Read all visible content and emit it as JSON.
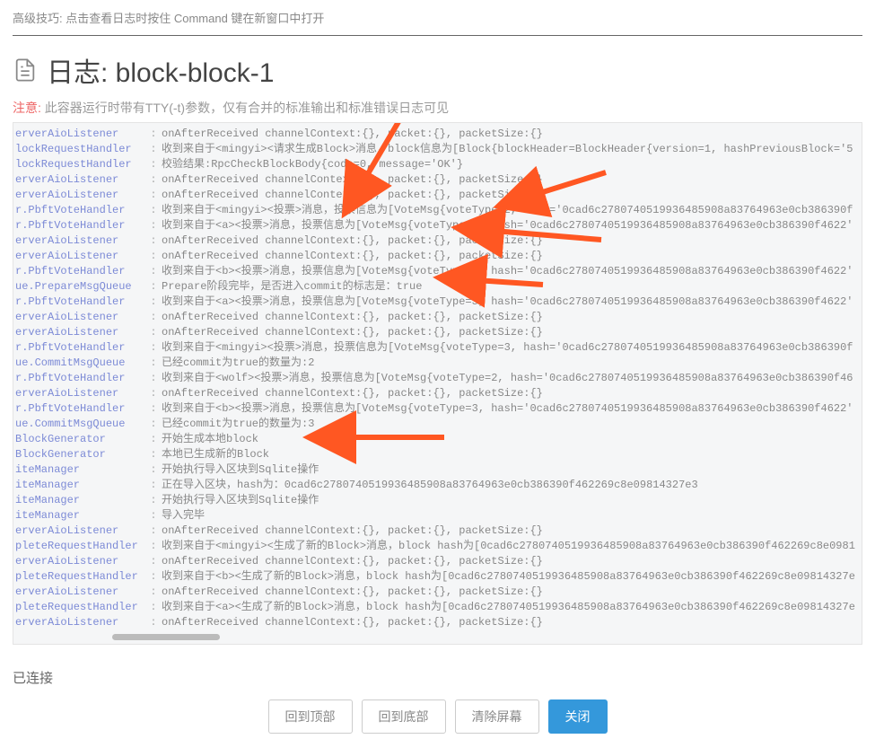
{
  "tip": "高级技巧: 点击查看日志时按住 Command 键在新窗口中打开",
  "title_prefix": "日志: ",
  "title_name": "block-block-1",
  "notice_label": "注意:",
  "notice_text": " 此容器运行时带有TTY(-t)参数，仅有合并的标准输出和标准错误日志可见",
  "status": "已连接",
  "buttons": {
    "top": "回到顶部",
    "bottom": "回到底部",
    "clear": "清除屏幕",
    "close": "关闭"
  },
  "log_lines": [
    {
      "src": "erverAioListener",
      "msg": "onAfterReceived channelContext:{}, packet:{}, packetSize:{}"
    },
    {
      "src": "lockRequestHandler",
      "msg": "收到来自于<mingyi><请求生成Block>消息，block信息为[Block{blockHeader=BlockHeader{version=1, hashPreviousBlock='5"
    },
    {
      "src": "lockRequestHandler",
      "msg": "校验结果:RpcCheckBlockBody{code=0, message='OK'}"
    },
    {
      "src": "erverAioListener",
      "msg": "onAfterReceived channelContext:{}, packet:{}, packetSize:{}"
    },
    {
      "src": "erverAioListener",
      "msg": "onAfterReceived channelContext:{}, packet:{}, packetSize:{}"
    },
    {
      "src": "r.PbftVoteHandler",
      "msg": "收到来自于<mingyi><投票>消息，投票信息为[VoteMsg{voteType=2, hash='0cad6c2780740519936485908a83764963e0cb386390f"
    },
    {
      "src": "r.PbftVoteHandler",
      "msg": "收到来自于<a><投票>消息，投票信息为[VoteMsg{voteType=2, hash='0cad6c2780740519936485908a83764963e0cb386390f4622'"
    },
    {
      "src": "erverAioListener",
      "msg": "onAfterReceived channelContext:{}, packet:{}, packetSize:{}"
    },
    {
      "src": "erverAioListener",
      "msg": "onAfterReceived channelContext:{}, packet:{}, packetSize:{}"
    },
    {
      "src": "r.PbftVoteHandler",
      "msg": "收到来自于<b><投票>消息，投票信息为[VoteMsg{voteType=2, hash='0cad6c2780740519936485908a83764963e0cb386390f4622'"
    },
    {
      "src": "ue.PrepareMsgQueue",
      "msg": "Prepare阶段完毕，是否进入commit的标志是：true"
    },
    {
      "src": "r.PbftVoteHandler",
      "msg": "收到来自于<a><投票>消息，投票信息为[VoteMsg{voteType=3, hash='0cad6c2780740519936485908a83764963e0cb386390f4622'"
    },
    {
      "src": "erverAioListener",
      "msg": "onAfterReceived channelContext:{}, packet:{}, packetSize:{}"
    },
    {
      "src": "erverAioListener",
      "msg": "onAfterReceived channelContext:{}, packet:{}, packetSize:{}"
    },
    {
      "src": "r.PbftVoteHandler",
      "msg": "收到来自于<mingyi><投票>消息，投票信息为[VoteMsg{voteType=3, hash='0cad6c2780740519936485908a83764963e0cb386390f"
    },
    {
      "src": "ue.CommitMsgQueue",
      "msg": "已经commit为true的数量为:2"
    },
    {
      "src": "r.PbftVoteHandler",
      "msg": "收到来自于<wolf><投票>消息，投票信息为[VoteMsg{voteType=2, hash='0cad6c2780740519936485908a83764963e0cb386390f46"
    },
    {
      "src": "erverAioListener",
      "msg": "onAfterReceived channelContext:{}, packet:{}, packetSize:{}"
    },
    {
      "src": "r.PbftVoteHandler",
      "msg": "收到来自于<b><投票>消息，投票信息为[VoteMsg{voteType=3, hash='0cad6c2780740519936485908a83764963e0cb386390f4622'"
    },
    {
      "src": "ue.CommitMsgQueue",
      "msg": "已经commit为true的数量为:3"
    },
    {
      "src": "BlockGenerator",
      "msg": "开始生成本地block"
    },
    {
      "src": "BlockGenerator",
      "msg": "本地已生成新的Block"
    },
    {
      "src": "iteManager",
      "msg": "开始执行导入区块到Sqlite操作"
    },
    {
      "src": "iteManager",
      "msg": "正在导入区块，hash为：0cad6c2780740519936485908a83764963e0cb386390f462269c8e09814327e3"
    },
    {
      "src": "iteManager",
      "msg": "开始执行导入区块到Sqlite操作"
    },
    {
      "src": "iteManager",
      "msg": "导入完毕"
    },
    {
      "src": "erverAioListener",
      "msg": "onAfterReceived channelContext:{}, packet:{}, packetSize:{}"
    },
    {
      "src": "pleteRequestHandler",
      "msg": "收到来自于<mingyi><生成了新的Block>消息，block hash为[0cad6c2780740519936485908a83764963e0cb386390f462269c8e0981"
    },
    {
      "src": "erverAioListener",
      "msg": "onAfterReceived channelContext:{}, packet:{}, packetSize:{}"
    },
    {
      "src": "pleteRequestHandler",
      "msg": "收到来自于<b><生成了新的Block>消息，block hash为[0cad6c2780740519936485908a83764963e0cb386390f462269c8e09814327e"
    },
    {
      "src": "erverAioListener",
      "msg": "onAfterReceived channelContext:{}, packet:{}, packetSize:{}"
    },
    {
      "src": "pleteRequestHandler",
      "msg": "收到来自于<a><生成了新的Block>消息，block hash为[0cad6c2780740519936485908a83764963e0cb386390f462269c8e09814327e"
    },
    {
      "src": "erverAioListener",
      "msg": "onAfterReceived channelContext:{}, packet:{}, packetSize:{}"
    }
  ]
}
